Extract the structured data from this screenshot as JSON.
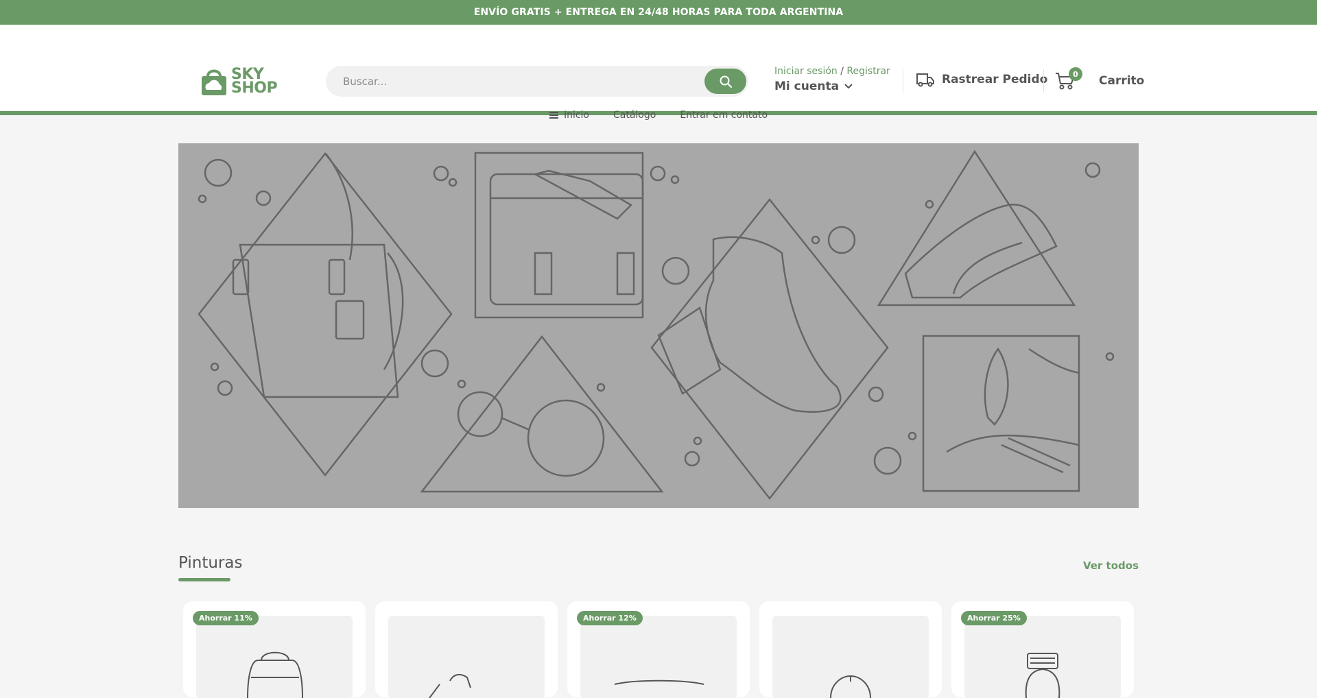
{
  "topbar": {
    "text": "ENVÍO GRATIS + ENTREGA EN 24/48 HORAS PARA TODA ARGENTINA"
  },
  "logo": {
    "line1": "SKY",
    "line2": "SHOP"
  },
  "search": {
    "placeholder": "Buscar..."
  },
  "account": {
    "login": "Iniciar sesión",
    "separator": "/",
    "register": "Registrar",
    "menu_label": "Mi cuenta"
  },
  "track": {
    "label": "Rastrear Pedido"
  },
  "cart": {
    "count": "0",
    "label": "Carrito"
  },
  "nav": {
    "items": [
      {
        "label": "Inicio"
      },
      {
        "label": "Catálogo"
      },
      {
        "label": "Entrar em contato"
      }
    ]
  },
  "section": {
    "title": "Pinturas",
    "see_all": "Ver todos"
  },
  "products": [
    {
      "badge": "Ahorrar 11%"
    },
    {
      "badge": ""
    },
    {
      "badge": "Ahorrar 12%"
    },
    {
      "badge": ""
    },
    {
      "badge": "Ahorrar 25%"
    }
  ],
  "colors": {
    "brand": "#6a9a66",
    "hero_bg": "#a8a8a8",
    "page_bg": "#f5f5f5"
  }
}
